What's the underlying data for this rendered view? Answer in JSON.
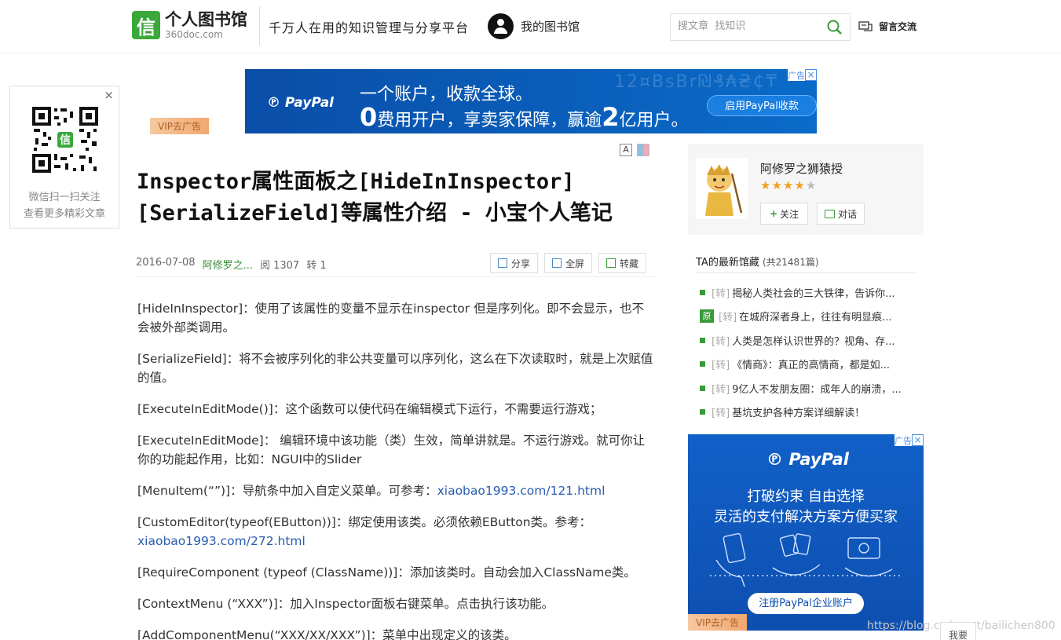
{
  "header": {
    "logo_cn": "个人图书馆",
    "logo_en": "360doc.com",
    "slogan": "千万人在用的知识管理与分享平台",
    "my_library": "我的图书馆",
    "search_placeholder": "搜文章  找知识",
    "message": "留言交流"
  },
  "qr": {
    "line1": "微信扫一扫关注",
    "line2": "查看更多精彩文章",
    "close": "×"
  },
  "vip_tag": "VIP去广告",
  "top_ad": {
    "badge": "广告",
    "brand": "PayPal",
    "line1": "一个账户，收款全球。",
    "line2_a": "0",
    "line2_b": "费用开户，享卖家保障，赢逾",
    "line2_c": "2",
    "line2_d": "亿用户。",
    "button": "启用PayPal收款",
    "bg_text": "12¤BsBr₪₰₳₴₵₸"
  },
  "article": {
    "font_icon": "A",
    "title": "Inspector属性面板之[HideInInspector] [SerializeField]等属性介绍 - 小宝个人笔记",
    "date": "2016-07-08",
    "author": "阿修罗之...",
    "reads": "阅 1307",
    "reposts": "转 1",
    "share": "分享",
    "fullscreen": "全屏",
    "collect": "转藏",
    "paragraphs": [
      {
        "text": "[HideInInspector]：使用了该属性的变量不显示在inspector 但是序列化。即不会显示，也不会被外部类调用。"
      },
      {
        "text": "[SerializeField]：将不会被序列化的非公共变量可以序列化，这么在下次读取时，就是上次赋值的值。"
      },
      {
        "text": "[ExecuteInEditMode()]：这个函数可以使代码在编辑模式下运行，不需要运行游戏；"
      },
      {
        "text": "[ExecuteInEditMode]：    编辑环境中该功能（类）生效，简单讲就是。不运行游戏。就可你让你的功能起作用，比如：NGUI中的Slider"
      },
      {
        "text": "[MenuItem(“”)]：导航条中加入自定义菜单。可参考：",
        "link": "xiaobao1993.com/121.html"
      },
      {
        "text": "[CustomEditor(typeof(EButton))]：绑定使用该类。必须依赖EButton类。参考：",
        "link": "xiaobao1993.com/272.html"
      },
      {
        "text": "[RequireComponent (typeof (ClassName))]：添加该类时。自动会加入ClassName类。"
      },
      {
        "text": "[ContextMenu (“XXX”)]：加入Inspector面板右键菜单。点击执行该功能。"
      },
      {
        "text": "[AddComponentMenu(“XXX/XX/XXX”)]：菜单中出现定义的该类。"
      }
    ]
  },
  "author_card": {
    "name": "阿修罗之狮猿授",
    "rating": 4,
    "rating_max": 5,
    "follow": "关注",
    "chat": "对话"
  },
  "latest": {
    "heading": "TA的最新馆藏",
    "count": "(共21481篇)",
    "items": [
      {
        "orig": "",
        "tag": "[转]",
        "title": "揭秘人类社会的三大铁律，告诉你..."
      },
      {
        "orig": "原",
        "tag": "[转]",
        "title": "在城府深者身上，往往有明显痕..."
      },
      {
        "orig": "",
        "tag": "[转]",
        "title": "人类是怎样认识世界的？视角、存..."
      },
      {
        "orig": "",
        "tag": "[转]",
        "title": "《情商》：真正的高情商，都是如..."
      },
      {
        "orig": "",
        "tag": "[转]",
        "title": "9亿人不发朋友圈：成年人的崩溃，..."
      },
      {
        "orig": "",
        "tag": "[转]",
        "title": "基坑支护各种方案详细解读！"
      }
    ]
  },
  "side_ad": {
    "badge": "广告",
    "brand": "PayPal",
    "line1": "打破约束 自由选择",
    "line2": "灵活的支付解决方案方便买家",
    "button": "注册PayPal企业账户"
  },
  "watermark": "https://blog.csdn.net/bailichen800",
  "float_button": "我要"
}
